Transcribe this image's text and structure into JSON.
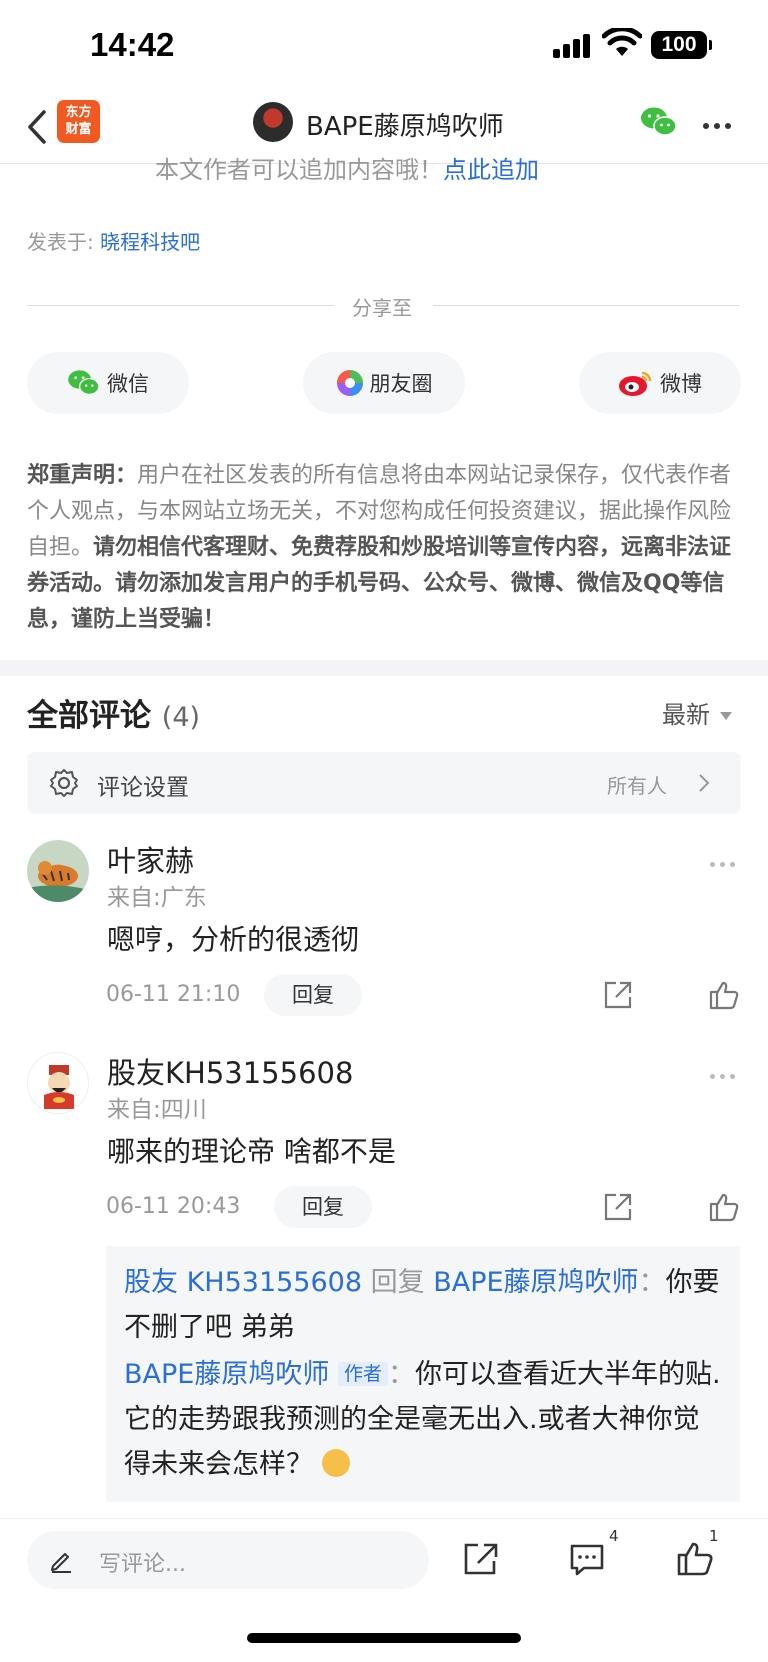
{
  "status": {
    "time": "14:42",
    "battery": "100"
  },
  "nav": {
    "logo_line1": "东方",
    "logo_line2": "财富",
    "title": "BAPE藤原鸠吹师"
  },
  "article": {
    "cutoff_text": "本文作者可以追加内容哦！",
    "cutoff_link": "点此追加",
    "posted_label": "发表于:",
    "posted_bar": "晓程科技吧"
  },
  "share": {
    "label": "分享至",
    "wechat": "微信",
    "moments": "朋友圈",
    "weibo": "微博"
  },
  "notice": {
    "heading": "郑重声明：",
    "body": "用户在社区发表的所有信息将由本网站记录保存，仅代表作者个人观点，与本网站立场无关，不对您构成任何投资建议，据此操作风险自担。",
    "warning": "请勿相信代客理财、免费荐股和炒股培训等宣传内容，远离非法证券活动。请勿添加发言用户的手机号码、公众号、微博、微信及QQ等信息，谨防上当受骗！"
  },
  "comments_header": {
    "title": "全部评论",
    "count": "(4)",
    "sort": "最新"
  },
  "comment_settings": {
    "label": "评论设置",
    "value": "所有人"
  },
  "comments": [
    {
      "name": "叶家赫",
      "location": "来自:广东",
      "text": "嗯哼，分析的很透彻",
      "time": "06-11 21:10",
      "reply_label": "回复"
    },
    {
      "name": "股友KH53155608",
      "location": "来自:四川",
      "text": "哪来的理论帝 啥都不是",
      "time": "06-11 20:43",
      "reply_label": "回复"
    }
  ],
  "replies": [
    {
      "from": "股友 KH53155608",
      "verb": "回复",
      "to": "BAPE藤原鸠吹师",
      "sep": "：",
      "text": "你要不删了吧 弟弟"
    },
    {
      "from": "BAPE藤原鸠吹师",
      "tag": "作者",
      "sep": "：",
      "text": "你可以查看近大半年的贴.它的走势跟我预测的全是毫无出入.或者大神你觉得未来会怎样？"
    }
  ],
  "bottom": {
    "placeholder": "写评论...",
    "comment_count": "4",
    "like_count": "1"
  }
}
